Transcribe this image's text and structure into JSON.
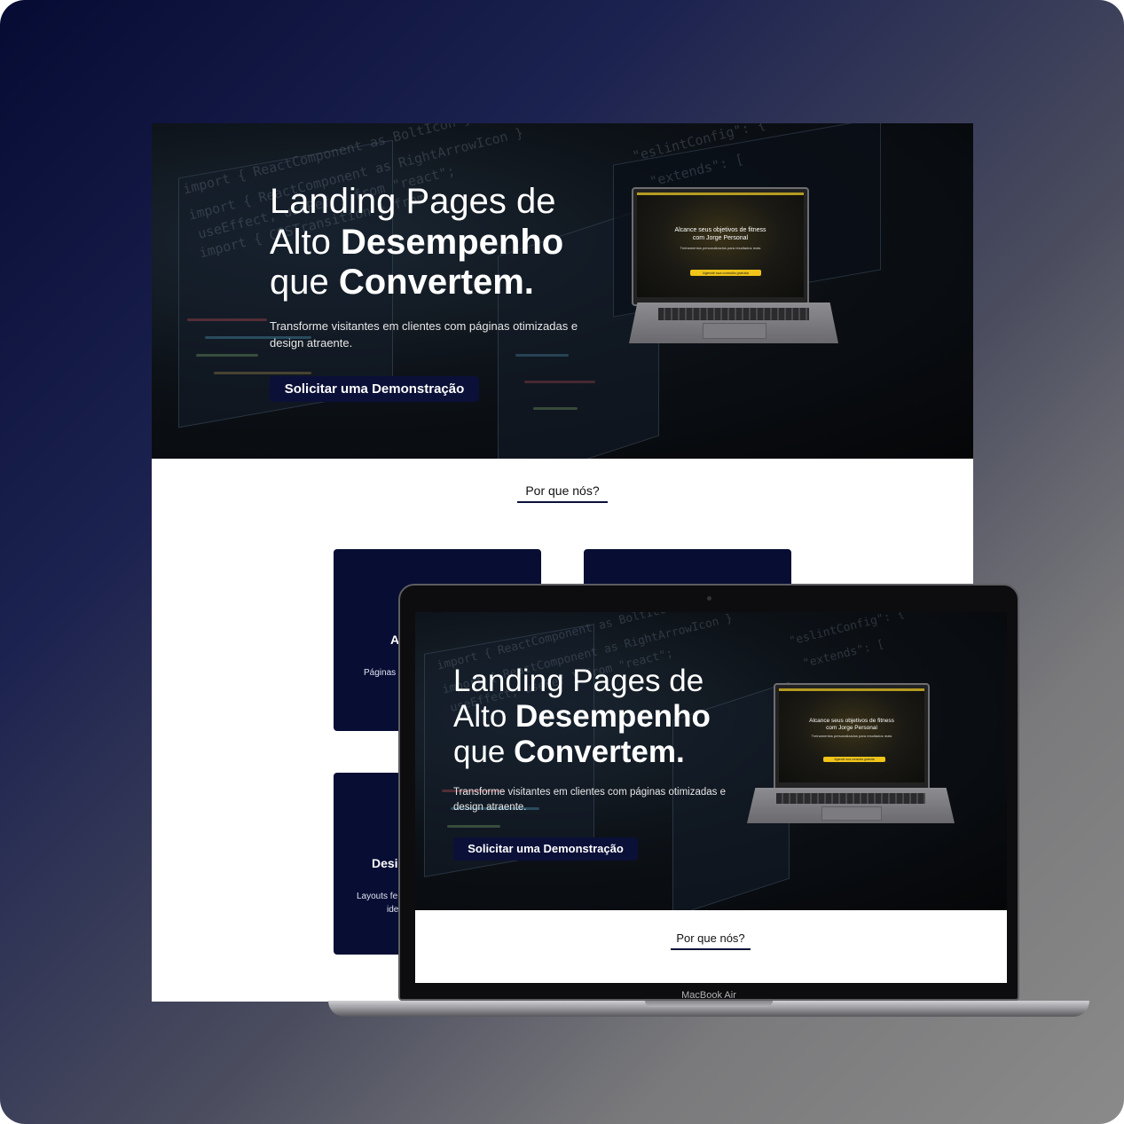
{
  "hero": {
    "title_line1": "Landing Pages de",
    "title_line2_plain": "Alto ",
    "title_line2_bold": "Desempenho",
    "title_line3_plain": "que ",
    "title_line3_bold": "Convertem.",
    "subtitle_line1": "Transforme visitantes em clientes com páginas otimizadas e",
    "subtitle_line2": "design atraente.",
    "cta_label": "Solicitar uma Demonstração"
  },
  "mockup_screen": {
    "title_line1": "Alcance seus objetivos de fitness",
    "title_line2": "com Jorge Personal",
    "subtitle": "Treinamentos personalizados para resultados reais",
    "cta_label": "Agende sua consulta gratuita"
  },
  "section": {
    "why_title": "Por que nós?"
  },
  "cards": [
    {
      "title": "A",
      "text": "Páginas"
    },
    {
      "title": "",
      "text": ""
    },
    {
      "title": "Desi",
      "text_line1": "Layouts fe",
      "text_line2": "ide"
    }
  ],
  "device": {
    "label": "MacBook Air"
  },
  "colors": {
    "navy": "#070d33",
    "cta_bg": "#0b1038",
    "accent_yellow": "#f0c419"
  }
}
